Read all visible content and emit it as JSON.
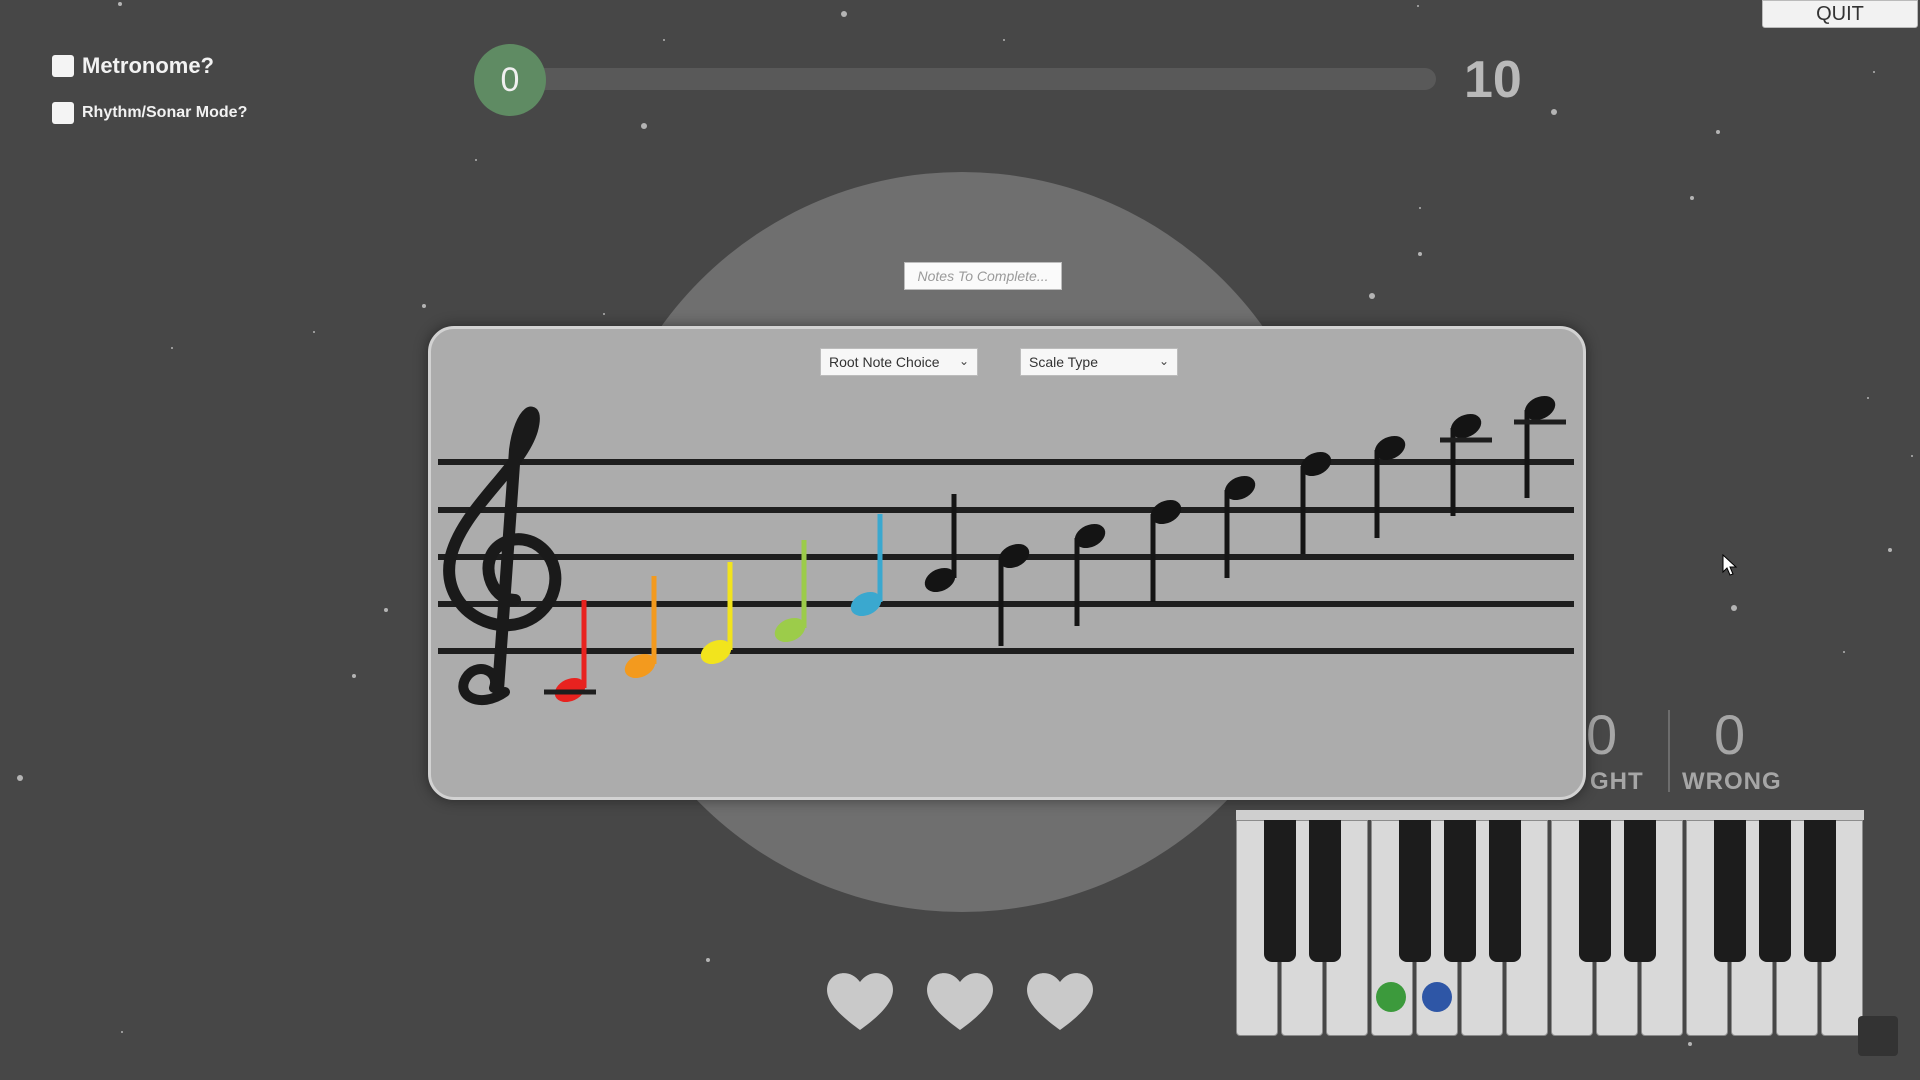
{
  "controls": {
    "quit_label": "QUIT",
    "metronome_label": "Metronome?",
    "rhythm_label": "Rhythm/Sonar Mode?",
    "metronome_checked": false,
    "rhythm_checked": false
  },
  "progress": {
    "current": "0",
    "goal": "10",
    "fraction": 0
  },
  "notes_field": {
    "placeholder": "Notes To Complete..."
  },
  "dropdowns": {
    "root_note": "Root Note Choice",
    "scale_type": "Scale Type"
  },
  "score": {
    "right_value": "0",
    "right_label": "GHT",
    "wrong_value": "0",
    "wrong_label": "WRONG"
  },
  "lives": {
    "count": 3,
    "icon": "heart-icon"
  },
  "staff": {
    "clef": "treble-clef-icon",
    "note_colors": [
      "#e8221f",
      "#f39a1e",
      "#f2e41d",
      "#9ccc4a",
      "#3aa8cf",
      "#141414",
      "#141414",
      "#141414",
      "#141414",
      "#141414",
      "#141414",
      "#141414",
      "#141414",
      "#141414"
    ]
  },
  "piano": {
    "highlighted_keys": [
      {
        "key": "white-4",
        "color": "#3c9a3c"
      },
      {
        "key": "white-5",
        "color": "#2e56a6"
      }
    ]
  }
}
